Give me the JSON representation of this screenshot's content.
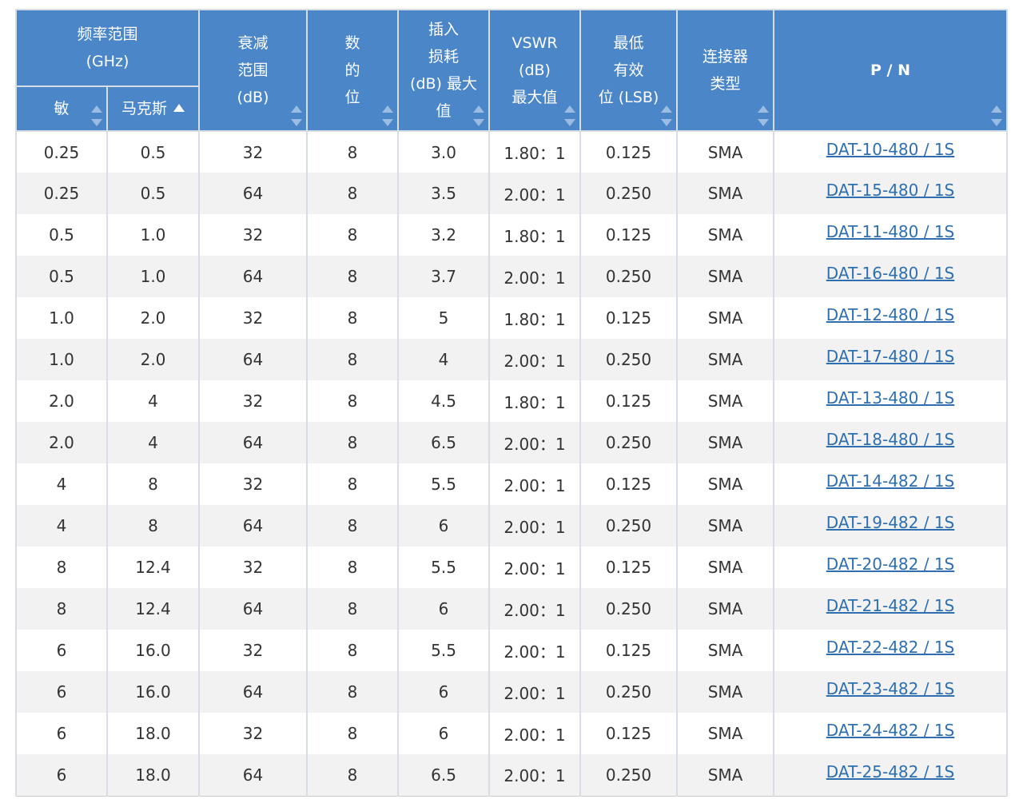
{
  "headers": {
    "freq_range": "频率范围\n(GHz)",
    "min": "敏",
    "max": "马克斯",
    "atten_range": "衰减\n范围\n(dB)",
    "bits": "数\n的\n位",
    "insertion_loss": "插入\n损耗\n(dB) 最大\n值",
    "vswr": "VSWR\n(dB)\n最大值",
    "lsb": "最低\n有效\n位 (LSB)",
    "connector": "连接器\n类型",
    "pn": "P / N"
  },
  "rows": [
    {
      "min": "0.25",
      "max": "0.5",
      "atten": "32",
      "bits": "8",
      "il": "3.0",
      "vswr": "1.80：1",
      "lsb": "0.125",
      "conn": "SMA",
      "pn": "DAT-10-480 / 1S"
    },
    {
      "min": "0.25",
      "max": "0.5",
      "atten": "64",
      "bits": "8",
      "il": "3.5",
      "vswr": "2.00：1",
      "lsb": "0.250",
      "conn": "SMA",
      "pn": "DAT-15-480 / 1S"
    },
    {
      "min": "0.5",
      "max": "1.0",
      "atten": "32",
      "bits": "8",
      "il": "3.2",
      "vswr": "1.80：1",
      "lsb": "0.125",
      "conn": "SMA",
      "pn": "DAT-11-480 / 1S"
    },
    {
      "min": "0.5",
      "max": "1.0",
      "atten": "64",
      "bits": "8",
      "il": "3.7",
      "vswr": "2.00：1",
      "lsb": "0.250",
      "conn": "SMA",
      "pn": "DAT-16-480 / 1S"
    },
    {
      "min": "1.0",
      "max": "2.0",
      "atten": "32",
      "bits": "8",
      "il": "5",
      "vswr": "1.80：1",
      "lsb": "0.125",
      "conn": "SMA",
      "pn": "DAT-12-480 / 1S"
    },
    {
      "min": "1.0",
      "max": "2.0",
      "atten": "64",
      "bits": "8",
      "il": "4",
      "vswr": "2.00：1",
      "lsb": "0.250",
      "conn": "SMA",
      "pn": "DAT-17-480 / 1S"
    },
    {
      "min": "2.0",
      "max": "4",
      "atten": "32",
      "bits": "8",
      "il": "4.5",
      "vswr": "1.80：1",
      "lsb": "0.125",
      "conn": "SMA",
      "pn": "DAT-13-480 / 1S"
    },
    {
      "min": "2.0",
      "max": "4",
      "atten": "64",
      "bits": "8",
      "il": "6.5",
      "vswr": "2.00：1",
      "lsb": "0.250",
      "conn": "SMA",
      "pn": "DAT-18-480 / 1S"
    },
    {
      "min": "4",
      "max": "8",
      "atten": "32",
      "bits": "8",
      "il": "5.5",
      "vswr": "2.00：1",
      "lsb": "0.125",
      "conn": "SMA",
      "pn": "DAT-14-482 / 1S"
    },
    {
      "min": "4",
      "max": "8",
      "atten": "64",
      "bits": "8",
      "il": "6",
      "vswr": "2.00：1",
      "lsb": "0.250",
      "conn": "SMA",
      "pn": "DAT-19-482 / 1S"
    },
    {
      "min": "8",
      "max": "12.4",
      "atten": "32",
      "bits": "8",
      "il": "5.5",
      "vswr": "2.00：1",
      "lsb": "0.125",
      "conn": "SMA",
      "pn": "DAT-20-482 / 1S"
    },
    {
      "min": "8",
      "max": "12.4",
      "atten": "64",
      "bits": "8",
      "il": "6",
      "vswr": "2.00：1",
      "lsb": "0.250",
      "conn": "SMA",
      "pn": "DAT-21-482 / 1S"
    },
    {
      "min": "6",
      "max": "16.0",
      "atten": "32",
      "bits": "8",
      "il": "5.5",
      "vswr": "2.00：1",
      "lsb": "0.125",
      "conn": "SMA",
      "pn": "DAT-22-482 / 1S"
    },
    {
      "min": "6",
      "max": "16.0",
      "atten": "64",
      "bits": "8",
      "il": "6",
      "vswr": "2.00：1",
      "lsb": "0.250",
      "conn": "SMA",
      "pn": "DAT-23-482 / 1S"
    },
    {
      "min": "6",
      "max": "18.0",
      "atten": "32",
      "bits": "8",
      "il": "6",
      "vswr": "2.00：1",
      "lsb": "0.125",
      "conn": "SMA",
      "pn": "DAT-24-482 / 1S"
    },
    {
      "min": "6",
      "max": "18.0",
      "atten": "64",
      "bits": "8",
      "il": "6.5",
      "vswr": "2.00：1",
      "lsb": "0.250",
      "conn": "SMA",
      "pn": "DAT-25-482 / 1S"
    }
  ],
  "colors": {
    "header_bg": "#4a86c8",
    "header_text": "#ffffff",
    "row_alt_bg": "#f2f2f2",
    "link": "#2f6fb0",
    "sort_inactive": "#9bbde3"
  },
  "icons": {
    "sort_both": "sort-both-icon",
    "sort_asc": "sort-ascending-icon"
  }
}
